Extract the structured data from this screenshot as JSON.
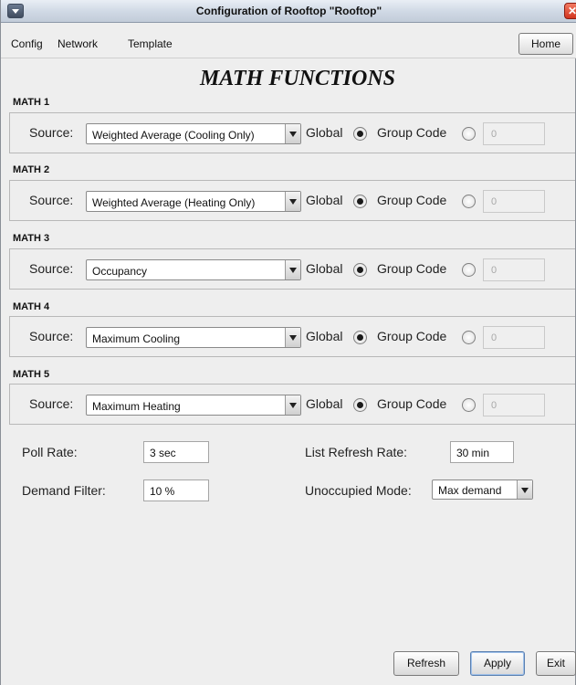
{
  "window": {
    "title": "Configuration of Rooftop \"Rooftop\"",
    "close_glyph": "✕"
  },
  "menubar": {
    "items": [
      "Config",
      "Network",
      "Template"
    ],
    "home_label": "Home"
  },
  "page_title": "MATH FUNCTIONS",
  "math_sections": [
    {
      "label": "MATH 1",
      "source_label": "Source:",
      "source_value": "Weighted Average (Cooling Only)",
      "global_label": "Global",
      "global_selected": true,
      "group_code_label": "Group Code",
      "group_code_value": "0"
    },
    {
      "label": "MATH 2",
      "source_label": "Source:",
      "source_value": "Weighted Average (Heating Only)",
      "global_label": "Global",
      "global_selected": true,
      "group_code_label": "Group Code",
      "group_code_value": "0"
    },
    {
      "label": "MATH 3",
      "source_label": "Source:",
      "source_value": "Occupancy",
      "global_label": "Global",
      "global_selected": true,
      "group_code_label": "Group Code",
      "group_code_value": "0"
    },
    {
      "label": "MATH 4",
      "source_label": "Source:",
      "source_value": "Maximum Cooling",
      "global_label": "Global",
      "global_selected": true,
      "group_code_label": "Group Code",
      "group_code_value": "0"
    },
    {
      "label": "MATH 5",
      "source_label": "Source:",
      "source_value": "Maximum Heating",
      "global_label": "Global",
      "global_selected": true,
      "group_code_label": "Group Code",
      "group_code_value": "0"
    }
  ],
  "options": {
    "poll_rate_label": "Poll Rate:",
    "poll_rate_value": "3 sec",
    "list_refresh_label": "List Refresh Rate:",
    "list_refresh_value": "30 min",
    "demand_filter_label": "Demand Filter:",
    "demand_filter_value": "10 %",
    "unoccupied_label": "Unoccupied Mode:",
    "unoccupied_value": "Max demand"
  },
  "buttons": {
    "refresh": "Refresh",
    "apply": "Apply",
    "exit": "Exit"
  }
}
